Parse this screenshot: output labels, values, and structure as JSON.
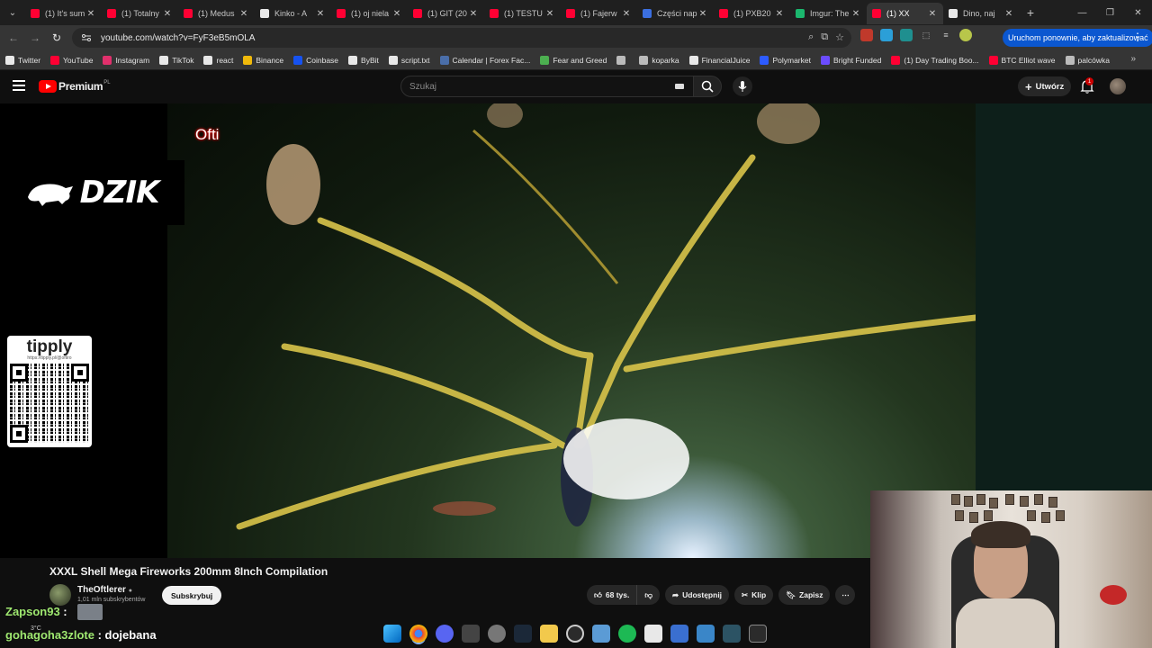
{
  "browser": {
    "tabs": [
      {
        "title": "(1) It's sum",
        "color": "#ff0033"
      },
      {
        "title": "(1) Totalny",
        "color": "#ff0033"
      },
      {
        "title": "(1) Medus",
        "color": "#ff0033"
      },
      {
        "title": "Kinko - A",
        "color": "#e8e8e8"
      },
      {
        "title": "(1) oj niela",
        "color": "#ff0033"
      },
      {
        "title": "(1) GIT (20",
        "color": "#ff0033"
      },
      {
        "title": "(1) TESTU",
        "color": "#ff0033"
      },
      {
        "title": "(1) Fajerw",
        "color": "#ff0033"
      },
      {
        "title": "Części nap",
        "color": "#3b6fe0"
      },
      {
        "title": "(1) PXB20",
        "color": "#ff0033"
      },
      {
        "title": "Imgur: The",
        "color": "#1bb76e"
      },
      {
        "title": "(1) XX",
        "color": "#ff0033",
        "active": true
      },
      {
        "title": "Dino, naj",
        "color": "#e8e8e8"
      }
    ],
    "new_tab": "+",
    "url": "youtube.com/watch?v=FyF3eB5mOLA",
    "update_button": "Uruchom ponownie, aby zaktualizować",
    "bookmarks": [
      {
        "label": "Twitter",
        "color": "#e8e8e8"
      },
      {
        "label": "YouTube",
        "color": "#ff0033"
      },
      {
        "label": "Instagram",
        "color": "#e1306c"
      },
      {
        "label": "TikTok",
        "color": "#e8e8e8"
      },
      {
        "label": "react",
        "color": "#e8e8e8"
      },
      {
        "label": "Binance",
        "color": "#f0b90b"
      },
      {
        "label": "Coinbase",
        "color": "#1652f0"
      },
      {
        "label": "ByBit",
        "color": "#e8e8e8"
      },
      {
        "label": "script.txt",
        "color": "#e8e8e8"
      },
      {
        "label": "Calendar | Forex Fac...",
        "color": "#4a6ea9"
      },
      {
        "label": "Fear and Greed",
        "color": "#4caf50"
      },
      {
        "label": "",
        "color": "#bbbbbb"
      },
      {
        "label": "koparka",
        "color": "#bbbbbb"
      },
      {
        "label": "FinancialJuice",
        "color": "#e8e8e8"
      },
      {
        "label": "Polymarket",
        "color": "#2d5bff"
      },
      {
        "label": "Bright Funded",
        "color": "#6b4cff"
      },
      {
        "label": "(1) Day Trading Boo...",
        "color": "#ff0033"
      },
      {
        "label": "BTC Elliot wave",
        "color": "#ff0033"
      },
      {
        "label": "palcówka",
        "color": "#bbbbbb"
      }
    ]
  },
  "youtube": {
    "logo_text": "Premium",
    "country": "PL",
    "search_placeholder": "Szukaj",
    "create_label": "Utwórz",
    "notification_count": "1",
    "video_title": "XXXL Shell Mega Fireworks 200mm 8Inch Compilation",
    "channel_name": "TheOftlerer",
    "channel_subs": "1,01 mln subskrybentów",
    "subscribe_label": "Subskrybuj",
    "likes": "68 tys.",
    "share_label": "Udostępnij",
    "clip_label": "Klip",
    "save_label": "Zapisz"
  },
  "overlay": {
    "ofti_label": "Ofti",
    "dzik_text": "DZIK",
    "tipply_name": "tipply",
    "tipply_url": "https://tipply.pl/@oftiro"
  },
  "chat": {
    "line1_user": "Zapson93",
    "line1_sep": " :",
    "line2_user": "gohagoha3zlote",
    "line2_sep": " : ",
    "line2_msg": "dojebana"
  },
  "weather": "3°C"
}
